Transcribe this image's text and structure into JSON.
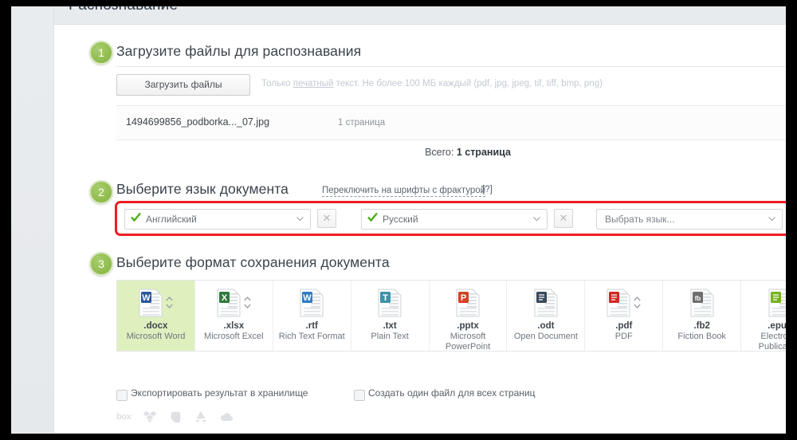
{
  "page": {
    "cut_heading": "Распознавание"
  },
  "steps": [
    {
      "number": "1",
      "title": "Загрузите файлы для распознавания"
    },
    {
      "number": "2",
      "title": "Выберите язык документа"
    },
    {
      "number": "3",
      "title": "Выберите формат сохранения документа"
    }
  ],
  "upload": {
    "button_label": "Загрузить файлы",
    "hint_prefix": "Только ",
    "hint_underlined": "печатный",
    "hint_suffix": " текст. Не более 100 МБ каждый (pdf, jpg, jpeg, tif, tiff, bmp, png)",
    "clear_icon": "close-icon",
    "file": {
      "name": "1494699856_podborka..._07.jpg",
      "pages": "1 страница",
      "delete_icon": "trash-icon"
    },
    "total_label": "Всего:",
    "total_value": "1 страница"
  },
  "language": {
    "fraktur_link": "Переключить на шрифты с фрактурой",
    "fraktur_help": "[?]",
    "highlight_color": "#ee1c24",
    "selects": [
      {
        "value": "Английский",
        "has_check": true,
        "clear_enabled": true
      },
      {
        "value": "Русский",
        "has_check": true,
        "clear_enabled": true
      },
      {
        "value": "Выбрать язык...",
        "has_check": false,
        "clear_enabled": false
      }
    ]
  },
  "formats": [
    {
      "ext": ".docx",
      "name": "Microsoft Word",
      "icon": "word-doc-icon",
      "badge_color": "#2b5797",
      "badge_letter": "W",
      "has_spinner": true,
      "selected": true
    },
    {
      "ext": ".xlsx",
      "name": "Microsoft Excel",
      "icon": "excel-doc-icon",
      "badge_color": "#31793b",
      "badge_letter": "X",
      "has_spinner": true,
      "selected": false
    },
    {
      "ext": ".rtf",
      "name": "Rich Text Format",
      "icon": "rtf-doc-icon",
      "badge_color": "#2f7cc4",
      "badge_letter": "W",
      "has_spinner": false,
      "selected": false
    },
    {
      "ext": ".txt",
      "name": "Plain Text",
      "icon": "text-doc-icon",
      "badge_color": "#3e93a8",
      "badge_letter": "T",
      "has_spinner": false,
      "selected": false
    },
    {
      "ext": ".pptx",
      "name": "Microsoft PowerPoint",
      "icon": "powerpoint-doc-icon",
      "badge_color": "#d14524",
      "badge_letter": "P",
      "has_spinner": false,
      "selected": false
    },
    {
      "ext": ".odt",
      "name": "Open Document",
      "icon": "opendocument-doc-icon",
      "badge_color": "#3a4a5c",
      "badge_letter": "",
      "has_spinner": false,
      "selected": false
    },
    {
      "ext": ".pdf",
      "name": "PDF",
      "icon": "pdf-doc-icon",
      "badge_color": "#cf2a27",
      "badge_letter": "",
      "has_spinner": true,
      "selected": false
    },
    {
      "ext": ".fb2",
      "name": "Fiction Book",
      "icon": "fictionbook-doc-icon",
      "badge_color": "#6e6e6e",
      "badge_letter": "fb",
      "has_spinner": false,
      "selected": false
    },
    {
      "ext": ".epub",
      "name": "Electronic Publication",
      "icon": "epub-doc-icon",
      "badge_color": "#76b31e",
      "badge_letter": "",
      "has_spinner": false,
      "selected": false
    }
  ],
  "options": [
    {
      "label": "Экспортировать результат в хранилище",
      "checked": false
    },
    {
      "label": "Создать один файл для всех страниц",
      "checked": false
    }
  ],
  "storage_services": [
    {
      "name": "box-icon",
      "label": "box"
    },
    {
      "name": "dropbox-icon",
      "label": ""
    },
    {
      "name": "evernote-icon",
      "label": ""
    },
    {
      "name": "google-drive-icon",
      "label": ""
    },
    {
      "name": "onedrive-icon",
      "label": ""
    }
  ]
}
